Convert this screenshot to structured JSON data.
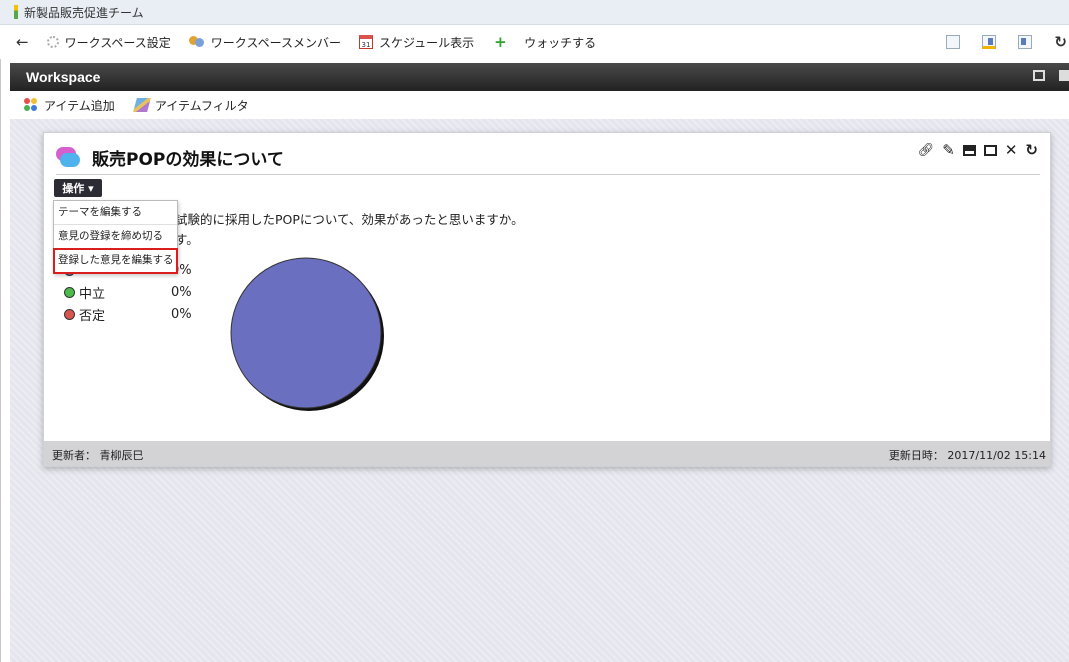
{
  "window": {
    "title": "新製品販売促進チーム"
  },
  "toolbar": {
    "workspace_settings": "ワークスペース設定",
    "workspace_members": "ワークスペースメンバー",
    "schedule_view": "スケジュール表示",
    "watch": "ウォッチする",
    "calendar_day": "31"
  },
  "workspace": {
    "title": "Workspace",
    "add_item": "アイテム追加",
    "item_filter": "アイテムフィルタ"
  },
  "card": {
    "title": "販売POPの効果について",
    "operations_button": "操作 ▾",
    "question_line1": "試験的に採用したPOPについて、効果があったと思いますか。",
    "question_line2": "す。",
    "legend": [
      {
        "label": "",
        "percent": "0%",
        "color": "#6b6fbf"
      },
      {
        "label": "中立",
        "percent": "0%",
        "color": "#4cbb4c"
      },
      {
        "label": "否定",
        "percent": "0%",
        "color": "#d9534f"
      }
    ],
    "pie_color": "#6b6fbf",
    "footer_updater": "更新者： 青柳辰巳",
    "footer_updated_at": "更新日時： 2017/11/02 15:14"
  },
  "menu": {
    "items": [
      "テーマを編集する",
      "意見の登録を締め切る",
      "登録した意見を編集する"
    ],
    "highlight_color": "#d91e1e"
  }
}
